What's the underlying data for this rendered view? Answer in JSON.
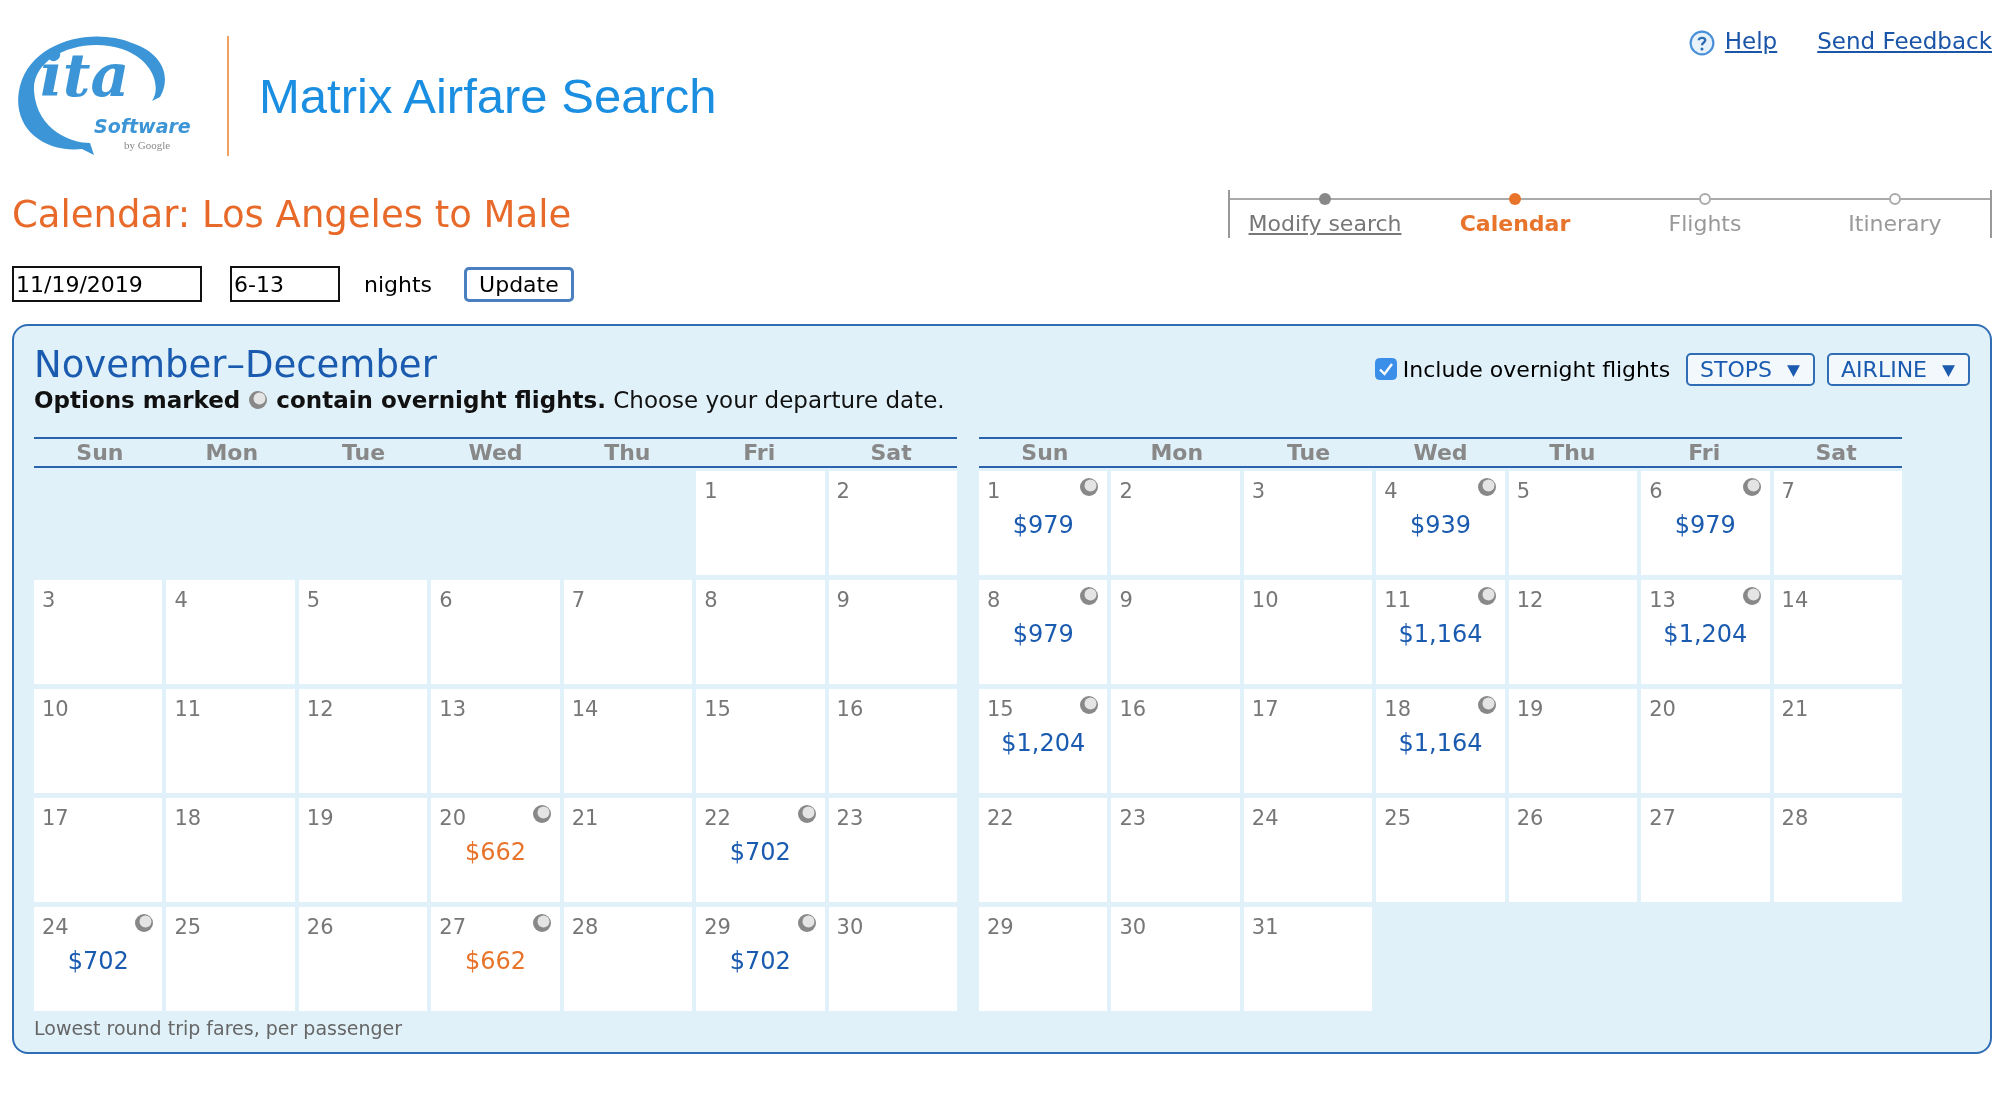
{
  "logo": {
    "main": "ita",
    "sub": "Software",
    "tag": "by Google"
  },
  "app_title": "Matrix Airfare Search",
  "top_links": [
    {
      "label": "Help",
      "kind": "help"
    },
    {
      "label": "Send Feedback",
      "kind": "plain"
    }
  ],
  "page_title": "Calendar: Los Angeles to Male",
  "steps": [
    {
      "label": "Modify search",
      "visited": true,
      "selected": false
    },
    {
      "label": "Calendar",
      "visited": true,
      "selected": true
    },
    {
      "label": "Flights",
      "visited": false,
      "selected": false
    },
    {
      "label": "Itinerary",
      "visited": false,
      "selected": false
    }
  ],
  "search": {
    "date": "11/19/2019",
    "nights": "6-13",
    "nights_label": "nights",
    "button": "Update"
  },
  "panel": {
    "title": "November–December",
    "note_bold_before": "Options marked",
    "note_bold_after": "contain overnight flights.",
    "note_rest": "Choose your departure date.",
    "overnight_filter": {
      "label": "Include overnight flights",
      "checked": true
    },
    "dropdowns": [
      "STOPS",
      "AIRLINE"
    ],
    "footer": "Lowest round trip fares, per passenger"
  },
  "months": [
    {
      "weekdays": [
        "Sun",
        "Mon",
        "Tue",
        "Wed",
        "Thu",
        "Fri",
        "Sat"
      ],
      "weeks": [
        [
          {
            "kind": "empty"
          },
          {
            "kind": "empty"
          },
          {
            "kind": "empty"
          },
          {
            "kind": "empty"
          },
          {
            "kind": "empty"
          },
          {
            "kind": "day",
            "day": "1",
            "overnight": false
          },
          {
            "kind": "day",
            "day": "2",
            "overnight": false
          }
        ],
        [
          {
            "kind": "day",
            "day": "3",
            "overnight": false
          },
          {
            "kind": "day",
            "day": "4",
            "overnight": false
          },
          {
            "kind": "day",
            "day": "5",
            "overnight": false
          },
          {
            "kind": "day",
            "day": "6",
            "overnight": false
          },
          {
            "kind": "day",
            "day": "7",
            "overnight": false
          },
          {
            "kind": "day",
            "day": "8",
            "overnight": false
          },
          {
            "kind": "day",
            "day": "9",
            "overnight": false
          }
        ],
        [
          {
            "kind": "day",
            "day": "10",
            "overnight": false
          },
          {
            "kind": "day",
            "day": "11",
            "overnight": false
          },
          {
            "kind": "day",
            "day": "12",
            "overnight": false
          },
          {
            "kind": "day",
            "day": "13",
            "overnight": false
          },
          {
            "kind": "day",
            "day": "14",
            "overnight": false
          },
          {
            "kind": "day",
            "day": "15",
            "overnight": false
          },
          {
            "kind": "day",
            "day": "16",
            "overnight": false
          }
        ],
        [
          {
            "kind": "day",
            "day": "17",
            "overnight": false
          },
          {
            "kind": "day",
            "day": "18",
            "overnight": false
          },
          {
            "kind": "day",
            "day": "19",
            "overnight": false
          },
          {
            "kind": "day",
            "day": "20",
            "overnight": true,
            "price": "$662",
            "cheapest": true
          },
          {
            "kind": "day",
            "day": "21",
            "overnight": false
          },
          {
            "kind": "day",
            "day": "22",
            "overnight": true,
            "price": "$702",
            "cheapest": false
          },
          {
            "kind": "day",
            "day": "23",
            "overnight": false
          }
        ],
        [
          {
            "kind": "day",
            "day": "24",
            "overnight": true,
            "price": "$702",
            "cheapest": false
          },
          {
            "kind": "day",
            "day": "25",
            "overnight": false
          },
          {
            "kind": "day",
            "day": "26",
            "overnight": false
          },
          {
            "kind": "day",
            "day": "27",
            "overnight": true,
            "price": "$662",
            "cheapest": true
          },
          {
            "kind": "day",
            "day": "28",
            "overnight": false
          },
          {
            "kind": "day",
            "day": "29",
            "overnight": true,
            "price": "$702",
            "cheapest": false
          },
          {
            "kind": "day",
            "day": "30",
            "overnight": false
          }
        ]
      ]
    },
    {
      "weekdays": [
        "Sun",
        "Mon",
        "Tue",
        "Wed",
        "Thu",
        "Fri",
        "Sat"
      ],
      "weeks": [
        [
          {
            "kind": "day",
            "day": "1",
            "overnight": true,
            "price": "$979",
            "cheapest": false
          },
          {
            "kind": "day",
            "day": "2",
            "overnight": false
          },
          {
            "kind": "day",
            "day": "3",
            "overnight": false
          },
          {
            "kind": "day",
            "day": "4",
            "overnight": true,
            "price": "$939",
            "cheapest": false
          },
          {
            "kind": "day",
            "day": "5",
            "overnight": false
          },
          {
            "kind": "day",
            "day": "6",
            "overnight": true,
            "price": "$979",
            "cheapest": false
          },
          {
            "kind": "day",
            "day": "7",
            "overnight": false
          }
        ],
        [
          {
            "kind": "day",
            "day": "8",
            "overnight": true,
            "price": "$979",
            "cheapest": false
          },
          {
            "kind": "day",
            "day": "9",
            "overnight": false
          },
          {
            "kind": "day",
            "day": "10",
            "overnight": false
          },
          {
            "kind": "day",
            "day": "11",
            "overnight": true,
            "price": "$1,164",
            "cheapest": false
          },
          {
            "kind": "day",
            "day": "12",
            "overnight": false
          },
          {
            "kind": "day",
            "day": "13",
            "overnight": true,
            "price": "$1,204",
            "cheapest": false
          },
          {
            "kind": "day",
            "day": "14",
            "overnight": false
          }
        ],
        [
          {
            "kind": "day",
            "day": "15",
            "overnight": true,
            "price": "$1,204",
            "cheapest": false
          },
          {
            "kind": "day",
            "day": "16",
            "overnight": false
          },
          {
            "kind": "day",
            "day": "17",
            "overnight": false
          },
          {
            "kind": "day",
            "day": "18",
            "overnight": true,
            "price": "$1,164",
            "cheapest": false
          },
          {
            "kind": "day",
            "day": "19",
            "overnight": false
          },
          {
            "kind": "day",
            "day": "20",
            "overnight": false
          },
          {
            "kind": "day",
            "day": "21",
            "overnight": false
          }
        ],
        [
          {
            "kind": "day",
            "day": "22",
            "overnight": false
          },
          {
            "kind": "day",
            "day": "23",
            "overnight": false
          },
          {
            "kind": "day",
            "day": "24",
            "overnight": false
          },
          {
            "kind": "day",
            "day": "25",
            "overnight": false
          },
          {
            "kind": "day",
            "day": "26",
            "overnight": false
          },
          {
            "kind": "day",
            "day": "27",
            "overnight": false
          },
          {
            "kind": "day",
            "day": "28",
            "overnight": false
          }
        ],
        [
          {
            "kind": "day",
            "day": "29",
            "overnight": false
          },
          {
            "kind": "day",
            "day": "30",
            "overnight": false
          },
          {
            "kind": "day",
            "day": "31",
            "overnight": false
          },
          {
            "kind": "empty"
          },
          {
            "kind": "empty"
          },
          {
            "kind": "empty"
          },
          {
            "kind": "empty"
          }
        ]
      ]
    }
  ]
}
